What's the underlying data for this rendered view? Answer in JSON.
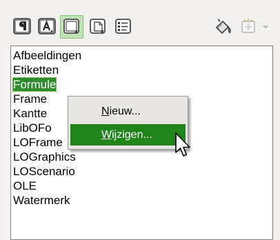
{
  "toolbar": {
    "buttons": [
      {
        "icon": "paragraph-styles-icon",
        "active": false
      },
      {
        "icon": "character-styles-icon",
        "active": false
      },
      {
        "icon": "frame-styles-icon",
        "active": true
      },
      {
        "icon": "page-styles-icon",
        "active": false
      },
      {
        "icon": "list-styles-icon",
        "active": false
      },
      {
        "icon": "fill-format-mode-icon",
        "active": false
      },
      {
        "icon": "new-style-from-selection-icon",
        "active": false
      }
    ],
    "accent": "#89c27c"
  },
  "style_list": {
    "items": [
      {
        "label": "Afbeeldingen"
      },
      {
        "label": "Etiketten"
      },
      {
        "label": "Formule"
      },
      {
        "label": "Frame"
      },
      {
        "label": "Kantte"
      },
      {
        "label": "LibOFo"
      },
      {
        "label": "LOFrame"
      },
      {
        "label": "LOGraphics"
      },
      {
        "label": "LOScenario"
      },
      {
        "label": "OLE"
      },
      {
        "label": "Watermerk"
      }
    ],
    "selected_index": 2,
    "selection_color": "#2e8b2e"
  },
  "context_menu": {
    "items": [
      {
        "mnemonic": "N",
        "rest": "ieuw..."
      },
      {
        "mnemonic": "W",
        "rest": "ijzigen..."
      }
    ],
    "hover_color": "#21841b"
  }
}
